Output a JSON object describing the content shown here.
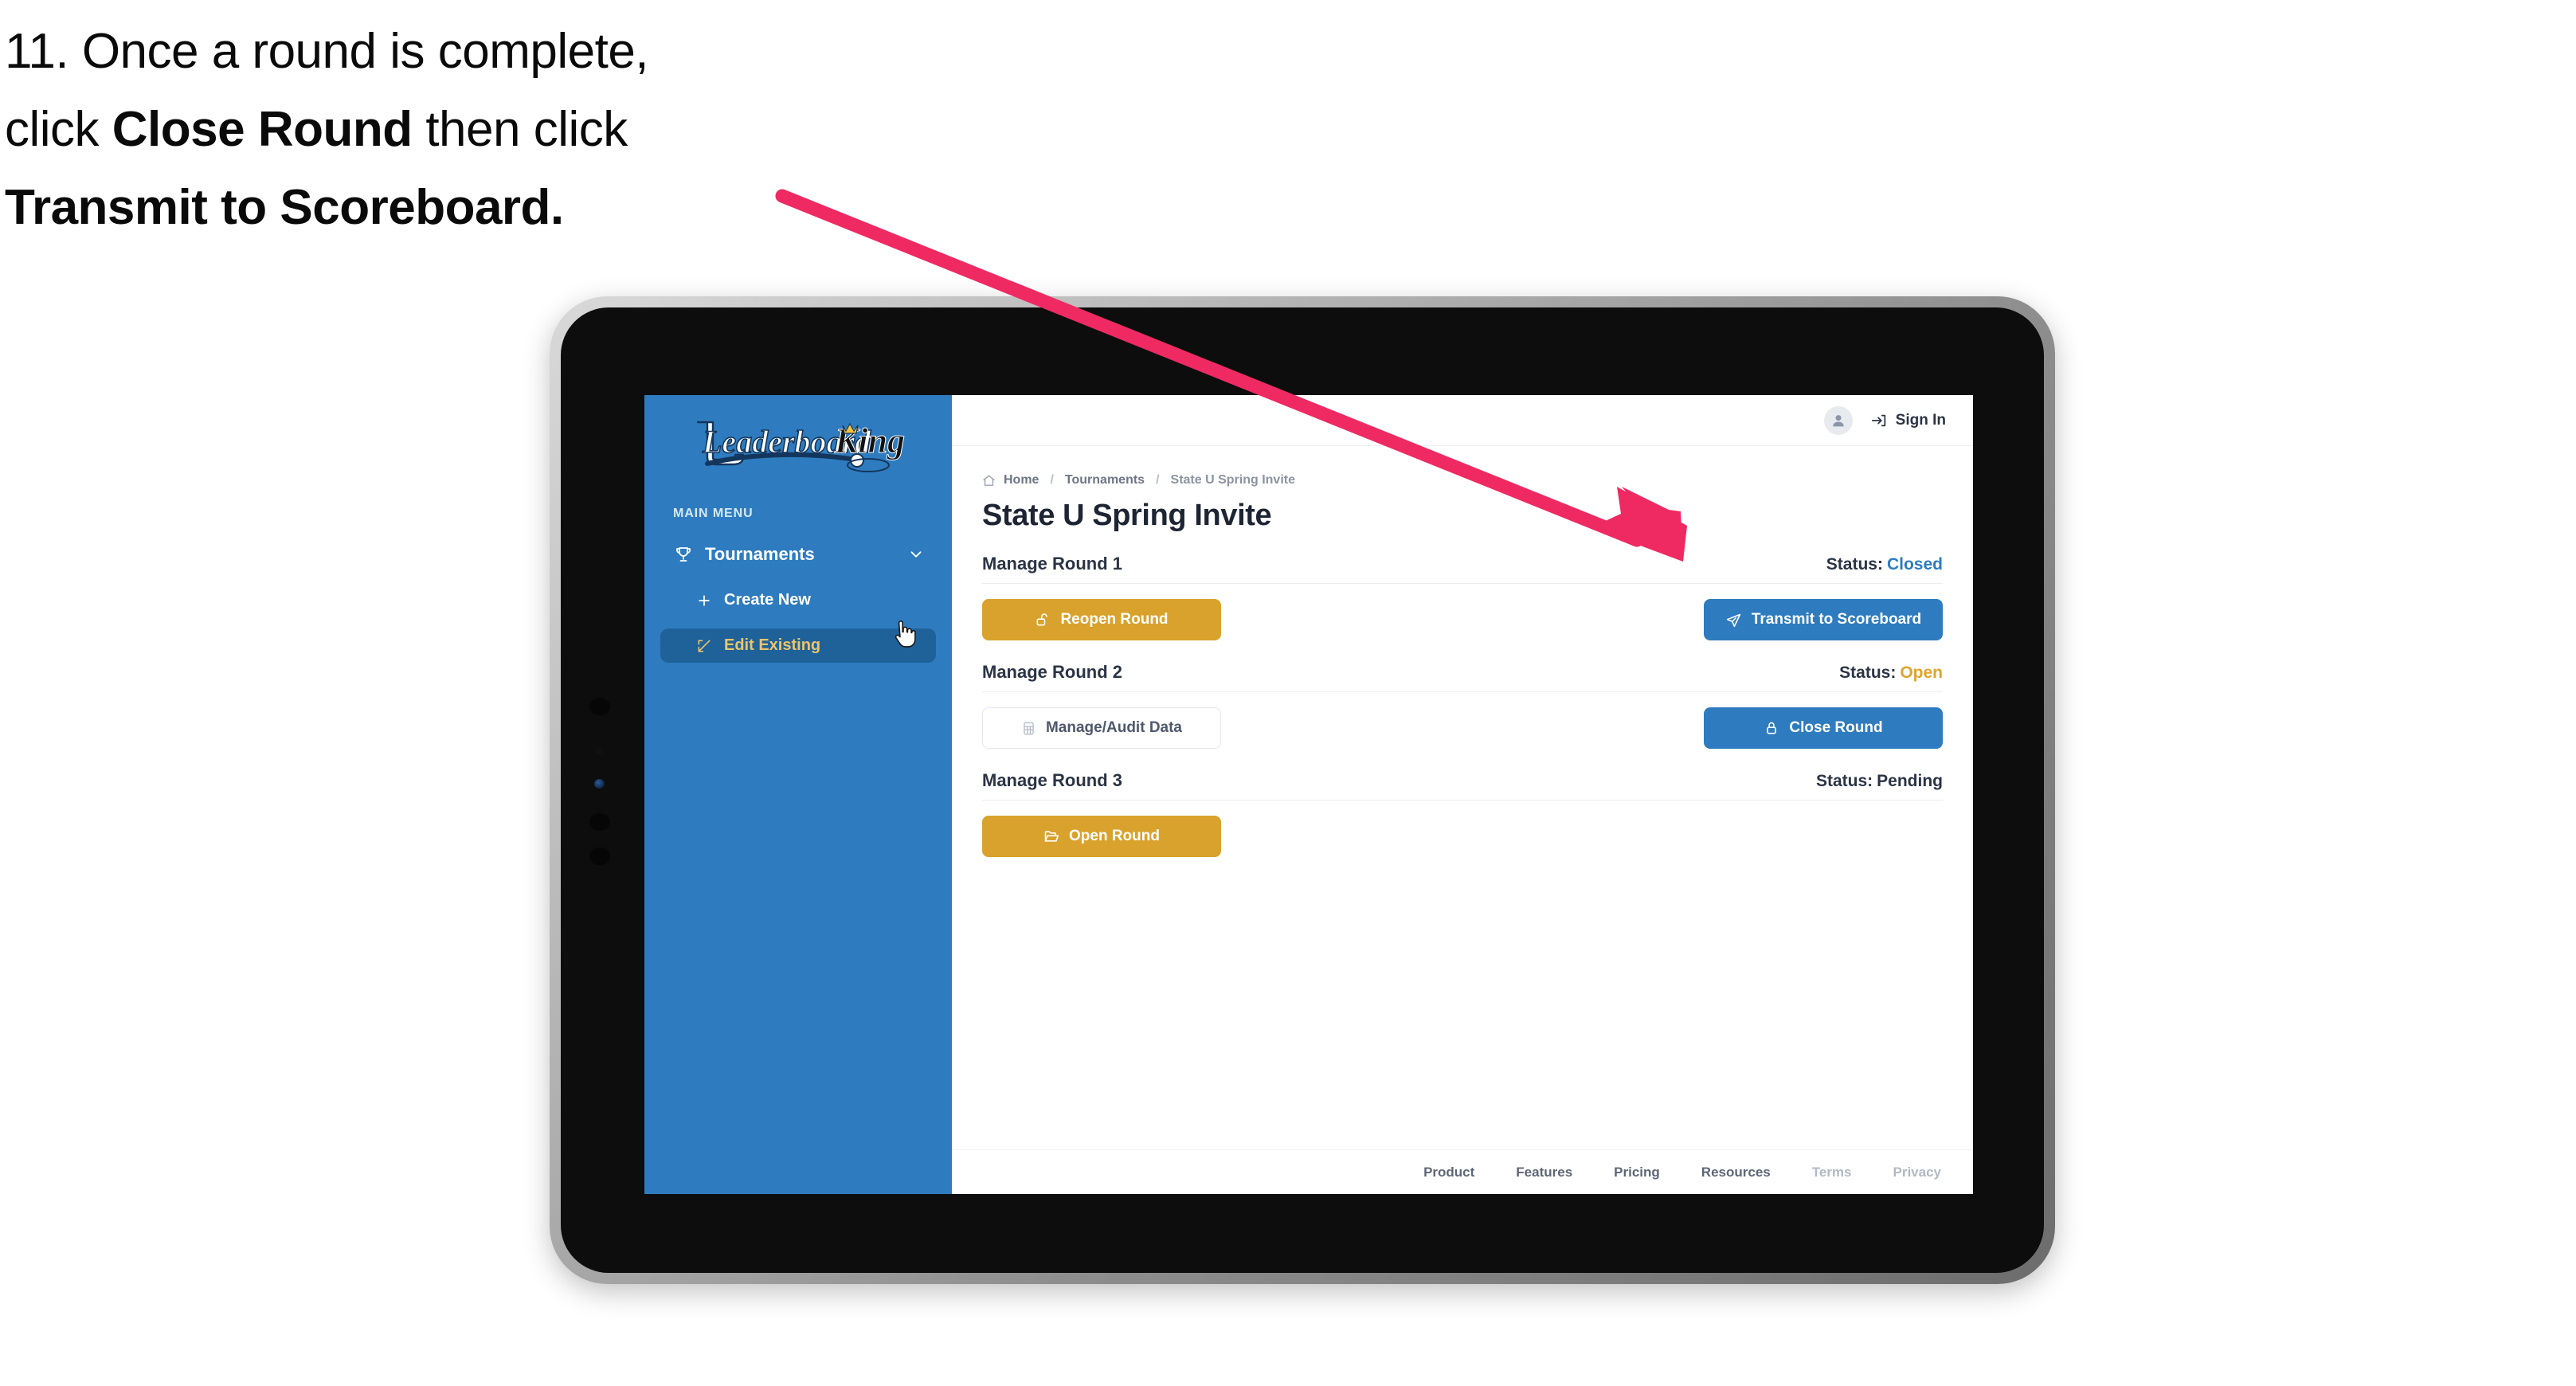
{
  "caption": {
    "line1_prefix": "11. Once a round is complete,",
    "line2_prefix": "click ",
    "line2_bold": "Close Round",
    "line2_suffix": " then click",
    "line3_bold": "Transmit to Scoreboard."
  },
  "annotation": {
    "arrow_color": "#ef2a63"
  },
  "app": {
    "sidebar": {
      "logo_text_left": "Leaderboard",
      "logo_text_right": "King",
      "menu_heading": "MAIN MENU",
      "items": [
        {
          "label": "Tournaments",
          "icon": "trophy-icon",
          "chevron": "chevron-down-icon",
          "active": false
        },
        {
          "label": "Create New",
          "icon": "plus-icon",
          "active": false
        },
        {
          "label": "Edit Existing",
          "icon": "edit-square-icon",
          "active": true
        }
      ]
    },
    "topbar": {
      "avatar_icon": "user-avatar-icon",
      "signin_icon": "sign-in-arrow-icon",
      "signin_label": "Sign In"
    },
    "breadcrumb": {
      "home_icon": "home-icon",
      "items": [
        "Home",
        "Tournaments",
        "State U Spring Invite"
      ],
      "separator": "/"
    },
    "page_title": "State U Spring Invite",
    "status_label": "Status:",
    "rounds": [
      {
        "name": "Manage Round 1",
        "status_value": "Closed",
        "status_class": "sv-closed",
        "left_button": {
          "label": "Reopen Round",
          "icon": "unlock-icon",
          "style": "btn-gold"
        },
        "right_button": {
          "label": "Transmit to Scoreboard",
          "icon": "paper-plane-icon",
          "style": "btn-blue"
        }
      },
      {
        "name": "Manage Round 2",
        "status_value": "Open",
        "status_class": "sv-open",
        "left_button": {
          "label": "Manage/Audit Data",
          "icon": "table-grid-icon",
          "style": "btn-ghost"
        },
        "right_button": {
          "label": "Close Round",
          "icon": "lock-icon",
          "style": "btn-blue"
        }
      },
      {
        "name": "Manage Round 3",
        "status_value": "Pending",
        "status_class": "sv-pending",
        "left_button": {
          "label": "Open Round",
          "icon": "folder-open-icon",
          "style": "btn-gold"
        },
        "right_button": null
      }
    ],
    "footer": {
      "links": [
        {
          "label": "Product",
          "muted": false
        },
        {
          "label": "Features",
          "muted": false
        },
        {
          "label": "Pricing",
          "muted": false
        },
        {
          "label": "Resources",
          "muted": false
        },
        {
          "label": "Terms",
          "muted": true
        },
        {
          "label": "Privacy",
          "muted": true
        }
      ]
    }
  },
  "colors": {
    "sidebar_blue": "#2e7cbf",
    "active_blue": "#1f6299",
    "accent_gold": "#d9a22c",
    "status_open_gold": "#e0a42c",
    "arrow_pink": "#ef2a63"
  }
}
